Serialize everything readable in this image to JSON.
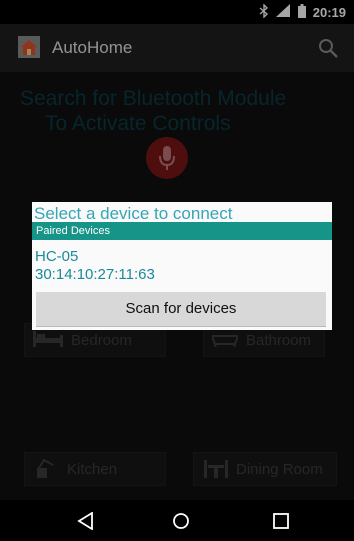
{
  "status_bar": {
    "time": "20:19",
    "icons": [
      "bluetooth-icon",
      "signal-icon",
      "battery-icon"
    ]
  },
  "action_bar": {
    "title": "AutoHome",
    "app_icon": "home-app-icon",
    "action_icon": "search-icon"
  },
  "main": {
    "headline_line1": "Search for Bluetooth Module",
    "headline_line2": "To Activate Controls",
    "mic_icon": "microphone-icon",
    "rooms": [
      {
        "label": "Bedroom",
        "icon": "bed-icon"
      },
      {
        "label": "Bathroom",
        "icon": "bathtub-icon"
      },
      {
        "label": "Kitchen",
        "icon": "kettle-icon"
      },
      {
        "label": "Dining Room",
        "icon": "dining-table-icon"
      }
    ]
  },
  "dialog": {
    "title": "Select a device to connect",
    "section_header": "Paired Devices",
    "devices": [
      {
        "name": "HC-05",
        "address": "30:14:10:27:11:63"
      }
    ],
    "scan_button_label": "Scan for devices"
  },
  "nav_bar": {
    "icons": [
      "back-icon",
      "home-icon",
      "recents-icon"
    ]
  },
  "colors": {
    "accent_teal": "#179488",
    "dialog_text": "#1a8a9b",
    "headline": "#0c3a44",
    "mic_button": "#7a1616"
  }
}
